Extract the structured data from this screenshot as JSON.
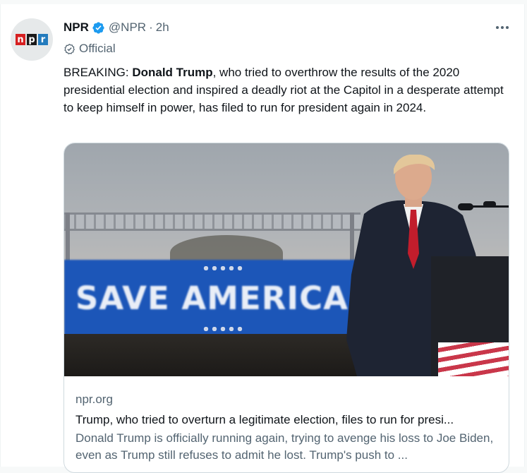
{
  "author": {
    "name": "NPR",
    "handle": "@NPR",
    "separator": "·",
    "time": "2h",
    "label": "Official",
    "avatar_logo": [
      "n",
      "p",
      "r"
    ]
  },
  "tweet": {
    "prefix": "BREAKING: ",
    "bold": "Donald Trump",
    "rest": ", who tried to overthrow the results of the 2020 presidential election and inspired a deadly riot at the Capitol in a desperate attempt to keep himself in power, has filed to run for president again in 2024."
  },
  "card": {
    "image_banner_text": "SAVE AMERICA",
    "domain": "npr.org",
    "title": "Trump, who tried to overturn a legitimate election, files to run for presi...",
    "description": "Donald Trump is officially running again, trying to avenge his loss to Joe Biden, even as Trump still refuses to admit he lost. Trump's push to ..."
  },
  "icons": {
    "verified": "verified-badge-icon",
    "official": "official-check-icon",
    "more": "more-options-icon"
  },
  "colors": {
    "accent": "#1d9bf0",
    "muted_text": "#536471",
    "banner_blue": "#1c56b8"
  }
}
